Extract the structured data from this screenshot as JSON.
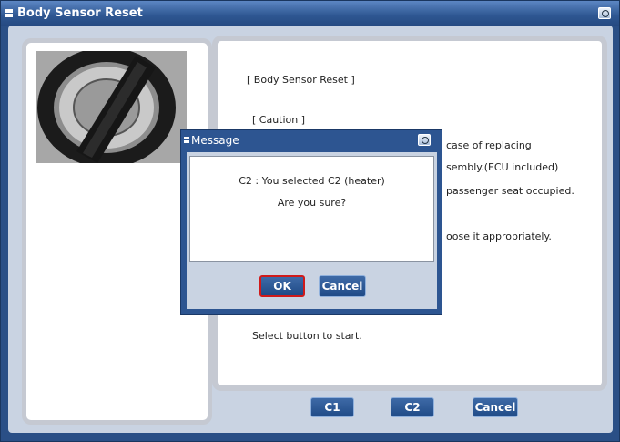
{
  "window": {
    "title": "Body Sensor Reset"
  },
  "main": {
    "heading": "[ Body Sensor Reset ]",
    "caution": "[ Caution ]",
    "line1": "case of replacing",
    "line2": "sembly.(ECU included)",
    "line3": "passenger seat occupied.",
    "line4": "oose it appropriately.",
    "start_prompt": "Select button to start."
  },
  "buttons": {
    "c1": "C1",
    "c2": "C2",
    "cancel": "Cancel"
  },
  "dialog": {
    "title": "Message",
    "line1": "C2 : You selected C2 (heater)",
    "line2": "Are you sure?",
    "ok": "OK",
    "cancel": "Cancel"
  },
  "icons": {
    "window_camera": "camera-icon",
    "dialog_camera": "camera-icon",
    "title_bullet": "bullet-icon"
  }
}
